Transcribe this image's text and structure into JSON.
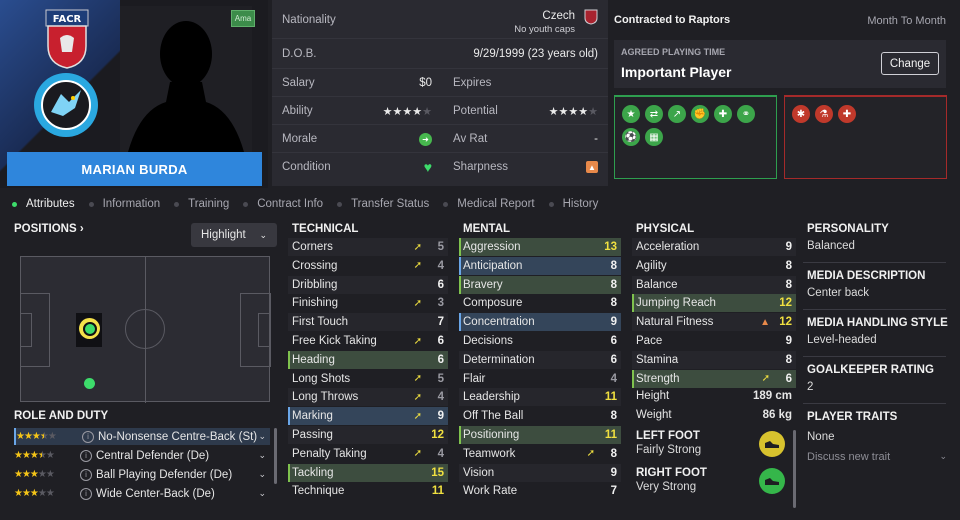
{
  "player": {
    "name": "MARIAN BURDA",
    "amateur_badge": "Ama"
  },
  "info": {
    "nationality_label": "Nationality",
    "nationality_value": "Czech",
    "youth_caps": "No youth caps",
    "dob_label": "D.O.B.",
    "dob_value": "9/29/1999 (23 years old)",
    "salary_label": "Salary",
    "salary_value": "$0",
    "expires_label": "Expires",
    "ability_label": "Ability",
    "ability_stars": 4,
    "potential_label": "Potential",
    "potential_stars": 4,
    "morale_label": "Morale",
    "avrat_label": "Av Rat",
    "avrat_value": "-",
    "condition_label": "Condition",
    "sharpness_label": "Sharpness"
  },
  "contract": {
    "title": "Contracted to Raptors",
    "type": "Month To Month",
    "apt_label": "AGREED PLAYING TIME",
    "apt_value": "Important Player",
    "change_label": "Change"
  },
  "tabs": [
    "Attributes",
    "Information",
    "Training",
    "Contract Info",
    "Transfer Status",
    "Medical Report",
    "History"
  ],
  "positions": {
    "label": "POSITIONS",
    "highlight_label": "Highlight"
  },
  "roles": {
    "label": "ROLE AND DUTY",
    "items": [
      {
        "name": "No-Nonsense Centre-Back (St)",
        "stars": 3.5
      },
      {
        "name": "Central Defender (De)",
        "stars": 3.5
      },
      {
        "name": "Ball Playing Defender (De)",
        "stars": 3
      },
      {
        "name": "Wide Center-Back (De)",
        "stars": 3
      }
    ]
  },
  "technical": {
    "label": "TECHNICAL",
    "rows": [
      {
        "name": "Corners",
        "value": "5",
        "arrow": "up",
        "style": ""
      },
      {
        "name": "Crossing",
        "value": "4",
        "arrow": "up",
        "style": ""
      },
      {
        "name": "Dribbling",
        "value": "6",
        "arrow": "",
        "style": ""
      },
      {
        "name": "Finishing",
        "value": "3",
        "arrow": "up",
        "style": ""
      },
      {
        "name": "First Touch",
        "value": "7",
        "arrow": "",
        "style": ""
      },
      {
        "name": "Free Kick Taking",
        "value": "6",
        "arrow": "up",
        "style": ""
      },
      {
        "name": "Heading",
        "value": "6",
        "arrow": "",
        "style": "g"
      },
      {
        "name": "Long Shots",
        "value": "5",
        "arrow": "up",
        "style": ""
      },
      {
        "name": "Long Throws",
        "value": "4",
        "arrow": "up",
        "style": ""
      },
      {
        "name": "Marking",
        "value": "9",
        "arrow": "up",
        "style": "b"
      },
      {
        "name": "Passing",
        "value": "12",
        "arrow": "",
        "style": ""
      },
      {
        "name": "Penalty Taking",
        "value": "4",
        "arrow": "up",
        "style": ""
      },
      {
        "name": "Tackling",
        "value": "15",
        "arrow": "",
        "style": "g"
      },
      {
        "name": "Technique",
        "value": "11",
        "arrow": "",
        "style": ""
      }
    ]
  },
  "mental": {
    "label": "MENTAL",
    "rows": [
      {
        "name": "Aggression",
        "value": "13",
        "arrow": "",
        "style": "g"
      },
      {
        "name": "Anticipation",
        "value": "8",
        "arrow": "",
        "style": "b"
      },
      {
        "name": "Bravery",
        "value": "8",
        "arrow": "",
        "style": "g"
      },
      {
        "name": "Composure",
        "value": "8",
        "arrow": "",
        "style": ""
      },
      {
        "name": "Concentration",
        "value": "9",
        "arrow": "",
        "style": "b"
      },
      {
        "name": "Decisions",
        "value": "6",
        "arrow": "",
        "style": ""
      },
      {
        "name": "Determination",
        "value": "6",
        "arrow": "",
        "style": ""
      },
      {
        "name": "Flair",
        "value": "4",
        "arrow": "",
        "style": ""
      },
      {
        "name": "Leadership",
        "value": "11",
        "arrow": "",
        "style": ""
      },
      {
        "name": "Off The Ball",
        "value": "8",
        "arrow": "",
        "style": ""
      },
      {
        "name": "Positioning",
        "value": "11",
        "arrow": "",
        "style": "g"
      },
      {
        "name": "Teamwork",
        "value": "8",
        "arrow": "up",
        "style": ""
      },
      {
        "name": "Vision",
        "value": "9",
        "arrow": "",
        "style": ""
      },
      {
        "name": "Work Rate",
        "value": "7",
        "arrow": "",
        "style": ""
      }
    ]
  },
  "physical": {
    "label": "PHYSICAL",
    "rows": [
      {
        "name": "Acceleration",
        "value": "9",
        "arrow": "",
        "style": ""
      },
      {
        "name": "Agility",
        "value": "8",
        "arrow": "",
        "style": ""
      },
      {
        "name": "Balance",
        "value": "8",
        "arrow": "",
        "style": ""
      },
      {
        "name": "Jumping Reach",
        "value": "12",
        "arrow": "",
        "style": "g"
      },
      {
        "name": "Natural Fitness",
        "value": "12",
        "arrow": "warn",
        "style": ""
      },
      {
        "name": "Pace",
        "value": "9",
        "arrow": "",
        "style": ""
      },
      {
        "name": "Stamina",
        "value": "8",
        "arrow": "",
        "style": ""
      },
      {
        "name": "Strength",
        "value": "6",
        "arrow": "up",
        "style": "g"
      }
    ],
    "height_label": "Height",
    "height_value": "189 cm",
    "weight_label": "Weight",
    "weight_value": "86 kg",
    "left_foot_label": "LEFT FOOT",
    "left_foot_value": "Fairly Strong",
    "right_foot_label": "RIGHT FOOT",
    "right_foot_value": "Very Strong"
  },
  "side": {
    "personality_label": "PERSONALITY",
    "personality_value": "Balanced",
    "media_desc_label": "MEDIA DESCRIPTION",
    "media_desc_value": "Center back",
    "media_style_label": "MEDIA HANDLING STYLE",
    "media_style_value": "Level-headed",
    "gk_label": "GOALKEEPER RATING",
    "gk_value": "2",
    "traits_label": "PLAYER TRAITS",
    "traits_value": "None",
    "discuss_label": "Discuss new trait"
  },
  "colors": {
    "accent_blue": "#2f86dc",
    "good_green": "#3ddc6b",
    "bad_red": "#c0392b",
    "value_yellow": "#f0e040"
  }
}
